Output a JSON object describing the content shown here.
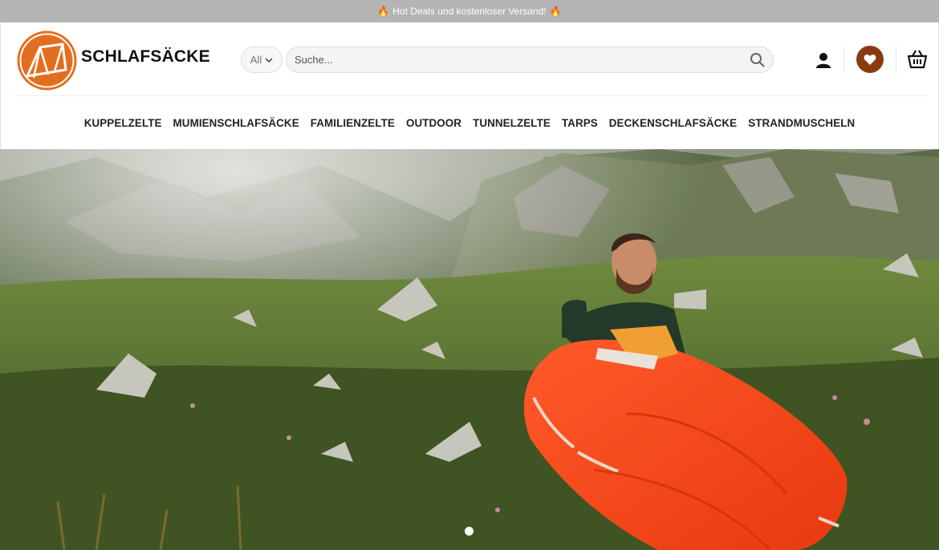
{
  "topbar": {
    "text": "Hot Deals und kostenloser Versand!",
    "icon": "fire-icon",
    "icon_color": "#f0a020"
  },
  "header": {
    "brand": "SCHLAFSÄCKE",
    "logo_color": "#e46e1f",
    "category_select": "All",
    "search_placeholder": "Suche...",
    "wishlist_color": "#8b3a10"
  },
  "nav": {
    "items": [
      {
        "label": "KUPPELZELTE"
      },
      {
        "label": "MUMIENSCHLAFSÄCKE"
      },
      {
        "label": "FAMILIENZELTE"
      },
      {
        "label": "OUTDOOR"
      },
      {
        "label": "TUNNELZELTE"
      },
      {
        "label": "TARPS"
      },
      {
        "label": "DECKENSCHLAFSÄCKE"
      },
      {
        "label": "STRANDMUSCHELN"
      }
    ]
  },
  "hero": {
    "image": "man-in-orange-sleeping-bag-on-mountain-meadow",
    "slide_count": 1,
    "active_slide": 1
  }
}
